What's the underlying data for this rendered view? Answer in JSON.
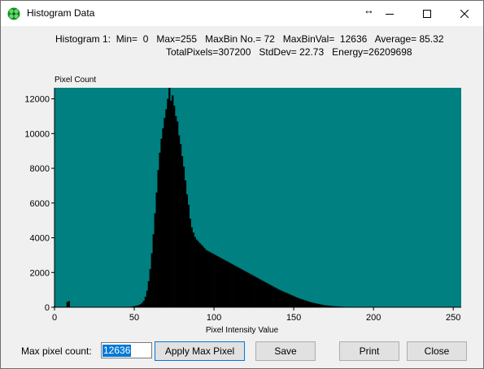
{
  "window": {
    "title": "Histogram Data",
    "icon": "green-clover-icon",
    "controls": [
      "resize-arrows-icon",
      "minimize-icon",
      "maximize-icon",
      "close-icon"
    ]
  },
  "stats": {
    "line1": "Histogram 1:  Min=  0   Max=255   MaxBin No.= 72   MaxBinVal=  12636   Average= 85.32",
    "line2": "TotalPixels=307200   StdDev= 22.73   Energy=26209698"
  },
  "chart_data": {
    "type": "bar",
    "ylabel": "Pixel Count",
    "xlabel": "Pixel Intensity Value",
    "xlim": [
      0,
      255
    ],
    "ylim": [
      0,
      12636
    ],
    "xticks": [
      0,
      50,
      100,
      150,
      200,
      250
    ],
    "yticks": [
      0,
      2000,
      4000,
      6000,
      8000,
      10000,
      12000
    ],
    "plot_background": "#008080",
    "bar_color": "#000000",
    "x": [
      0,
      1,
      2,
      3,
      4,
      5,
      6,
      7,
      8,
      9,
      10,
      11,
      12,
      13,
      14,
      15,
      16,
      17,
      18,
      19,
      20,
      21,
      22,
      23,
      24,
      25,
      26,
      27,
      28,
      29,
      30,
      31,
      32,
      33,
      34,
      35,
      36,
      37,
      38,
      39,
      40,
      41,
      42,
      43,
      44,
      45,
      46,
      47,
      48,
      49,
      50,
      51,
      52,
      53,
      54,
      55,
      56,
      57,
      58,
      59,
      60,
      61,
      62,
      63,
      64,
      65,
      66,
      67,
      68,
      69,
      70,
      71,
      72,
      73,
      74,
      75,
      76,
      77,
      78,
      79,
      80,
      81,
      82,
      83,
      84,
      85,
      86,
      87,
      88,
      89,
      90,
      91,
      92,
      93,
      94,
      95,
      96,
      97,
      98,
      99,
      100,
      101,
      102,
      103,
      104,
      105,
      106,
      107,
      108,
      109,
      110,
      111,
      112,
      113,
      114,
      115,
      116,
      117,
      118,
      119,
      120,
      121,
      122,
      123,
      124,
      125,
      126,
      127,
      128,
      129,
      130,
      131,
      132,
      133,
      134,
      135,
      136,
      137,
      138,
      139,
      140,
      141,
      142,
      143,
      144,
      145,
      146,
      147,
      148,
      149,
      150,
      151,
      152,
      153,
      154,
      155,
      156,
      157,
      158,
      159,
      160,
      161,
      162,
      163,
      164,
      165,
      166,
      167,
      168,
      169,
      170,
      171,
      172,
      173,
      174,
      175,
      176,
      177,
      178,
      179,
      180,
      181,
      182,
      183,
      184,
      185,
      186,
      187,
      188,
      189,
      190,
      191,
      192,
      193,
      194,
      195,
      196,
      197,
      198,
      199,
      200,
      201,
      202,
      203,
      204,
      205,
      206,
      207,
      208,
      209,
      210,
      211,
      212,
      213,
      214,
      215,
      216,
      217,
      218,
      219,
      220,
      221,
      222,
      223,
      224,
      225,
      226,
      227,
      228,
      229,
      230,
      231,
      232,
      233,
      234,
      235,
      236,
      237,
      238,
      239,
      240,
      241,
      242,
      243,
      244,
      245,
      246,
      247,
      248,
      249,
      250,
      251,
      252,
      253,
      254,
      255
    ],
    "values": [
      50,
      0,
      0,
      0,
      0,
      0,
      0,
      0,
      300,
      350,
      0,
      0,
      0,
      0,
      0,
      0,
      0,
      0,
      0,
      0,
      0,
      0,
      0,
      0,
      0,
      0,
      0,
      0,
      0,
      0,
      0,
      0,
      0,
      0,
      0,
      0,
      0,
      0,
      0,
      0,
      0,
      0,
      0,
      0,
      0,
      0,
      10,
      20,
      30,
      50,
      60,
      80,
      100,
      130,
      180,
      260,
      380,
      600,
      950,
      1500,
      2200,
      3100,
      4200,
      5400,
      6600,
      7900,
      8900,
      9700,
      10300,
      10900,
      11400,
      12000,
      12636,
      11900,
      12200,
      11600,
      11000,
      10700,
      9900,
      9400,
      8700,
      8100,
      7300,
      6500,
      5900,
      5100,
      4600,
      4300,
      4050,
      3900,
      3800,
      3700,
      3600,
      3500,
      3400,
      3300,
      3250,
      3200,
      3150,
      3100,
      3050,
      3000,
      2950,
      2900,
      2850,
      2800,
      2750,
      2700,
      2650,
      2600,
      2550,
      2500,
      2450,
      2400,
      2350,
      2300,
      2250,
      2200,
      2150,
      2100,
      2050,
      2000,
      1950,
      1900,
      1850,
      1800,
      1750,
      1700,
      1650,
      1600,
      1550,
      1500,
      1450,
      1400,
      1350,
      1300,
      1250,
      1200,
      1150,
      1100,
      1050,
      1000,
      960,
      920,
      880,
      840,
      800,
      760,
      720,
      680,
      640,
      600,
      560,
      520,
      490,
      460,
      430,
      400,
      370,
      340,
      310,
      280,
      260,
      240,
      220,
      200,
      180,
      160,
      140,
      120,
      110,
      100,
      90,
      80,
      70,
      60,
      55,
      50,
      45,
      40,
      35,
      30,
      25,
      20,
      18,
      16,
      14,
      12,
      10,
      8,
      6,
      5,
      4,
      3,
      2,
      1,
      0,
      0,
      0,
      0,
      0,
      0,
      0,
      0,
      0,
      0,
      0,
      0,
      0,
      0,
      0,
      0,
      0,
      0,
      0,
      0,
      0,
      0,
      0,
      0,
      0,
      0,
      0,
      0,
      0,
      0,
      0,
      0,
      0,
      0,
      0,
      0,
      0,
      0,
      0,
      0,
      0,
      0,
      0,
      0,
      0,
      0,
      0,
      0,
      0,
      0,
      0,
      0,
      0,
      0,
      0,
      0,
      0,
      0,
      0,
      0,
      0,
      0,
      0,
      0,
      0,
      0,
      0,
      0,
      0,
      0,
      0,
      0,
      0,
      0,
      0,
      0,
      0,
      0,
      0,
      0,
      0,
      0
    ]
  },
  "controls": {
    "max_pixel_label": "Max pixel count:",
    "max_pixel_value": "12636",
    "apply_label": "Apply Max Pixel",
    "save_label": "Save",
    "print_label": "Print",
    "close_label": "Close"
  }
}
